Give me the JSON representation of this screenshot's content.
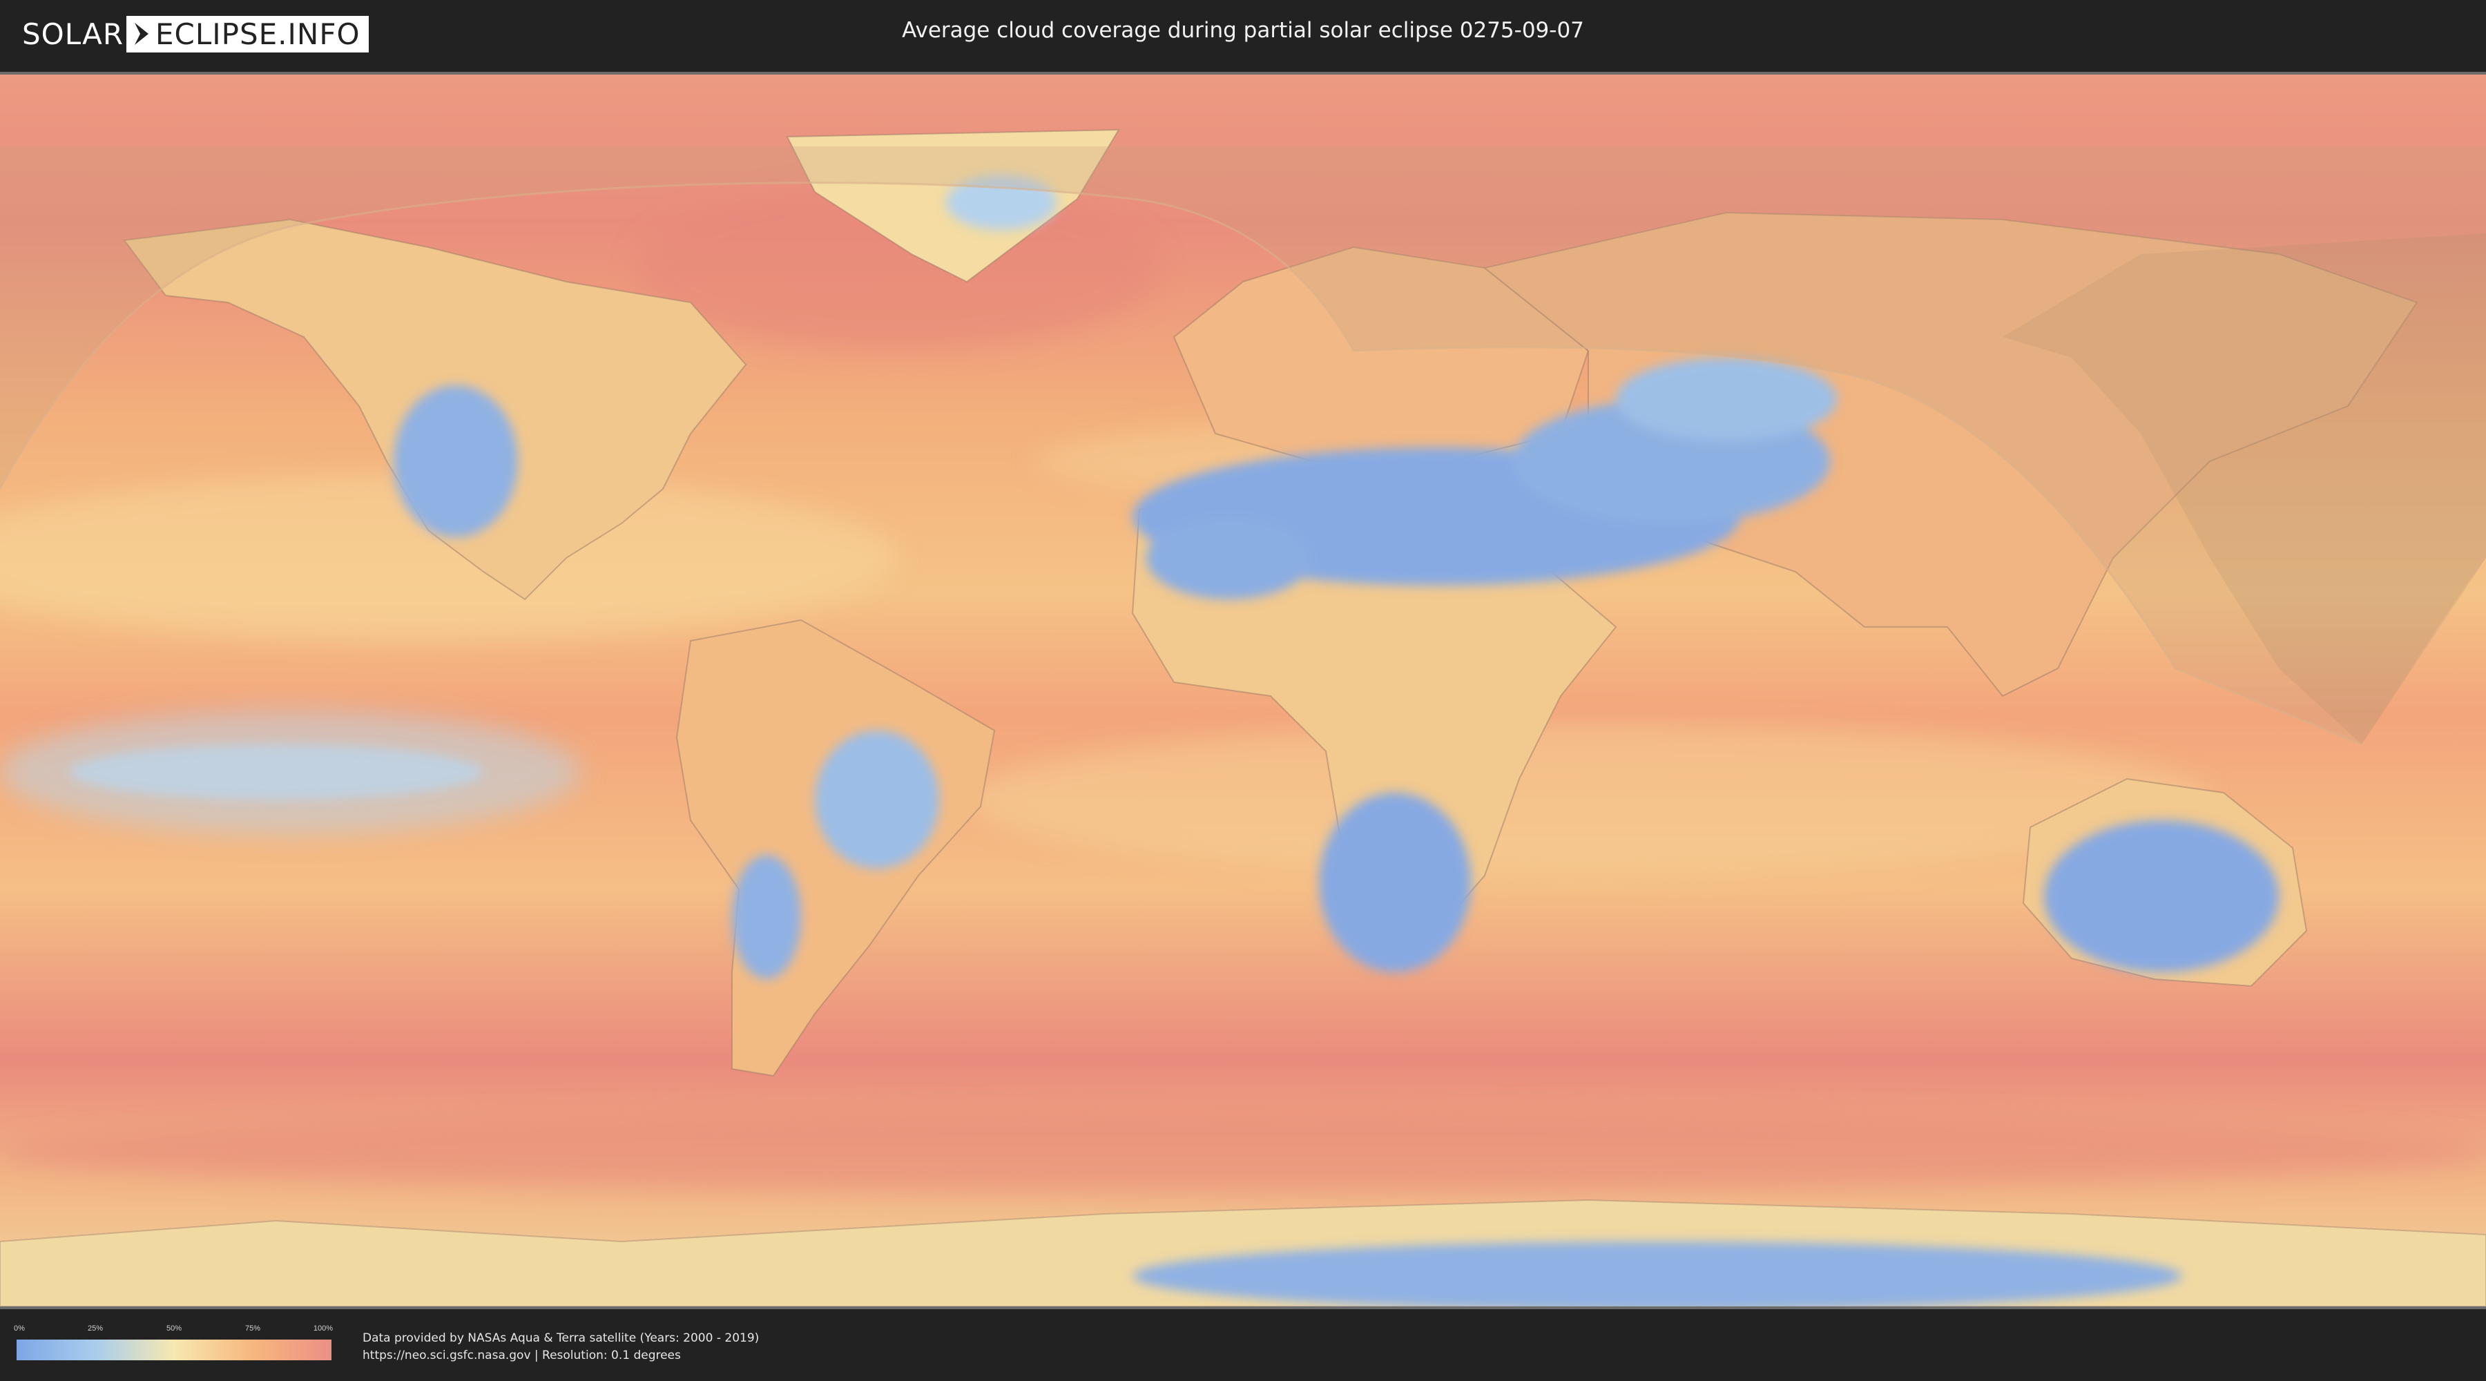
{
  "header": {
    "logo_left": "SOLAR",
    "logo_right": "ECLIPSE.INFO",
    "title": "Average cloud coverage during partial solar eclipse 0275-09-07"
  },
  "legend": {
    "ticks": [
      "0%",
      "25%",
      "50%",
      "75%",
      "100%"
    ],
    "colors": [
      "#7ea6e6",
      "#a9cdec",
      "#f6e8b0",
      "#f6b77e",
      "#ec8f86"
    ]
  },
  "credits": {
    "line1": "Data provided by NASAs Aqua & Terra satellite (Years: 2000 - 2019)",
    "line2": "https://neo.sci.gsfc.nasa.gov | Resolution: 0.1 degrees"
  },
  "map": {
    "layer": "cloud coverage",
    "overlay": "partial eclipse visibility zone",
    "colors": {
      "clear": "#7ea6e6",
      "low": "#a9cdec",
      "mid": "#f6e8b0",
      "high": "#f4b27d",
      "overcast": "#ea8f84",
      "eclipse_zone": "#c9a27e"
    }
  }
}
